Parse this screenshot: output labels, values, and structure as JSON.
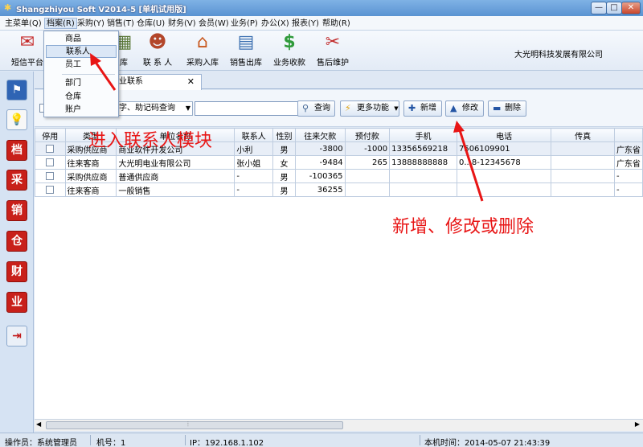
{
  "window": {
    "title": "Shangzhiyou Soft V2014-5 [单机试用版]",
    "min": "—",
    "max": "□",
    "close": "✕"
  },
  "menu": [
    {
      "label": "主菜单(Q)"
    },
    {
      "label": "档案(R)"
    },
    {
      "label": "采购(Y)"
    },
    {
      "label": "销售(T)"
    },
    {
      "label": "仓库(U)"
    },
    {
      "label": "财务(V)"
    },
    {
      "label": "会员(W)"
    },
    {
      "label": "业务(P)"
    },
    {
      "label": "办公(X)"
    },
    {
      "label": "报表(Y)"
    },
    {
      "label": "帮助(R)"
    }
  ],
  "dropdown": {
    "items": [
      {
        "label": "商品"
      },
      {
        "label": "联系人"
      },
      {
        "label": "员工"
      },
      {
        "label": "部门"
      },
      {
        "label": "仓库"
      },
      {
        "label": "账户"
      }
    ]
  },
  "toolbar": {
    "items": [
      {
        "label": "短信平台",
        "icon": "envelope-icon"
      },
      {
        "label": "库",
        "icon": "warehouse-icon"
      },
      {
        "label": "联 系 人",
        "icon": "contact-person-icon"
      },
      {
        "label": "采购入库",
        "icon": "purchase-house-icon"
      },
      {
        "label": "销售出库",
        "icon": "sales-register-icon"
      },
      {
        "label": "业务收款",
        "icon": "dollar-icon"
      },
      {
        "label": "售后维护",
        "icon": "tools-icon"
      }
    ],
    "company": "大光明科技发展有限公司"
  },
  "sidebar": {
    "items": [
      {
        "glyph": "⚑",
        "icon": "flag-icon"
      },
      {
        "glyph": "💡",
        "icon": "lightbulb-icon"
      },
      {
        "glyph": "档",
        "icon": "archive-icon"
      },
      {
        "glyph": "采",
        "icon": "purchase-icon"
      },
      {
        "glyph": "销",
        "icon": "sales-icon"
      },
      {
        "glyph": "仓",
        "icon": "warehouse-icon"
      },
      {
        "glyph": "财",
        "icon": "finance-icon"
      },
      {
        "glyph": "业",
        "icon": "business-icon"
      },
      {
        "glyph": "⇥",
        "icon": "exit-door-icon"
      }
    ]
  },
  "tab": {
    "label": "业联系",
    "close": "✕"
  },
  "search": {
    "combo": "字、助记码查询",
    "input_value": "",
    "buttons": {
      "query": "查询",
      "more": "更多功能",
      "add": "新增",
      "edit": "修改",
      "delete": "删除"
    }
  },
  "grid": {
    "columns": [
      "停用",
      "类型",
      "单位名称",
      "联系人",
      "性别",
      "往来欠款",
      "预付款",
      "手机",
      "电话",
      "传真",
      ""
    ],
    "rows": [
      {
        "type": "采购供应商",
        "company": "商业软件开发公司",
        "contact": "小利",
        "gender": "男",
        "owed": "-3800",
        "prepaid": "-1000",
        "mobile": "13356569218",
        "phone": "7506109901",
        "fax": "",
        "extra": "广东省"
      },
      {
        "type": "往来客商",
        "company": "大光明电业有限公司",
        "contact": "张小姐",
        "gender": "女",
        "owed": "-9484",
        "prepaid": "265",
        "mobile": "13888888888",
        "phone": "0...8-12345678",
        "fax": "",
        "extra": "广东省"
      },
      {
        "type": "采购供应商",
        "company": "普通供应商",
        "contact": "-",
        "gender": "男",
        "owed": "-100365",
        "prepaid": "",
        "mobile": "",
        "phone": "",
        "fax": "",
        "extra": "-"
      },
      {
        "type": "往来客商",
        "company": "一般销售",
        "contact": "-",
        "gender": "男",
        "owed": "36255",
        "prepaid": "",
        "mobile": "",
        "phone": "",
        "fax": "",
        "extra": "-"
      }
    ]
  },
  "status": {
    "operator": "操作员：系统管理员",
    "machine": "机号：1",
    "ip": "IP：192.168.1.102",
    "time": "本机时间：2014-05-07 21:43:39"
  },
  "annotations": {
    "enter": "进入联系人模块",
    "modify": "新增、修改或删除"
  }
}
